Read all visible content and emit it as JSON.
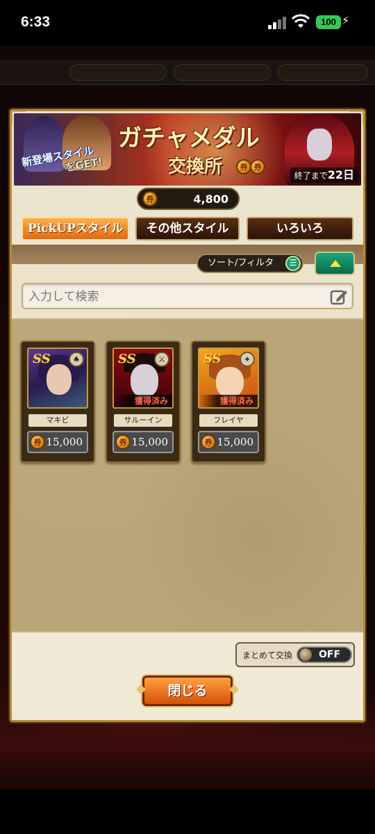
{
  "status_bar": {
    "time": "6:33",
    "battery": "100"
  },
  "banner": {
    "title": "ガチャメダル",
    "subtitle": "交換所",
    "tag_line1": "新登場スタイル",
    "tag_line2": "をGET!",
    "ends_prefix": "終了まで",
    "ends_value": "22日"
  },
  "currency": {
    "icon": "medal-icon",
    "value": "4,800"
  },
  "tabs": [
    {
      "label": "PickUPスタイル",
      "active": true
    },
    {
      "label": "その他スタイル",
      "active": false
    },
    {
      "label": "いろいろ",
      "active": false
    }
  ],
  "sort_filter_label": "ソート/フィルタ",
  "search": {
    "placeholder": "入力して検索"
  },
  "cards": [
    {
      "name": "マキビ",
      "cost": "15,000",
      "rank": "SS",
      "obtained": ""
    },
    {
      "name": "サルーイン",
      "cost": "15,000",
      "rank": "SS",
      "obtained": "獲得済み"
    },
    {
      "name": "フレイヤ",
      "cost": "15,000",
      "rank": "SS",
      "obtained": "獲得済み"
    }
  ],
  "bulk_exchange": {
    "label": "まとめて交換",
    "state": "OFF"
  },
  "close_button": "閉じる",
  "colors": {
    "accent_orange": "#e06a10",
    "frame_gold": "#b48a3a",
    "toggle_green": "#1c9a6a"
  }
}
